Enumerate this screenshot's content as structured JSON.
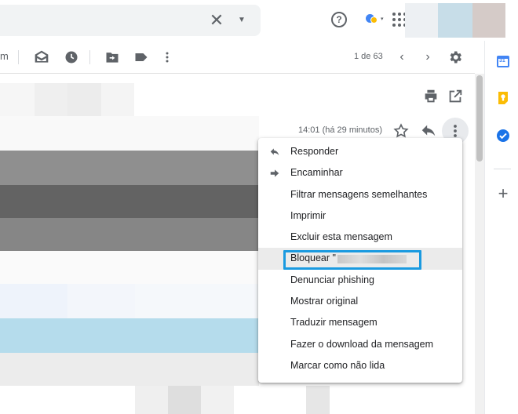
{
  "header": {
    "search_clear_glyph": "✕",
    "search_options_glyph": "▼",
    "help_glyph": "?",
    "status_caret_glyph": "▾",
    "icons": [
      "close-icon",
      "caret-down-icon",
      "help-icon",
      "status-icon",
      "apps-grid-icon"
    ]
  },
  "toolbar": {
    "partial_label": "m",
    "pager": "1 de 63",
    "prev_glyph": "‹",
    "next_glyph": "›",
    "icons": [
      "mark-read-icon",
      "snooze-icon",
      "move-to-icon",
      "label-icon",
      "more-vert-icon",
      "settings-icon"
    ]
  },
  "message": {
    "time": "14:01 (há 29 minutos)",
    "icons": [
      "print-icon",
      "open-new-window-icon",
      "star-icon",
      "reply-icon",
      "more-vert-icon"
    ]
  },
  "menu": {
    "items": [
      {
        "label": "Responder",
        "icon": "reply-icon"
      },
      {
        "label": "Encaminhar",
        "icon": "forward-icon"
      },
      {
        "label": "Filtrar mensagens semelhantes"
      },
      {
        "label": "Imprimir"
      },
      {
        "label": "Excluir esta mensagem"
      },
      {
        "label": "Bloquear \"",
        "blurred": true
      },
      {
        "label": "Denunciar phishing"
      },
      {
        "label": "Mostrar original"
      },
      {
        "label": "Traduzir mensagem"
      },
      {
        "label": "Fazer o download da mensagem"
      },
      {
        "label": "Marcar como não lida"
      }
    ]
  },
  "sidepanel": {
    "calendar_label": "31",
    "add_glyph": "+",
    "icons": [
      "calendar-icon",
      "keep-icon",
      "tasks-icon",
      "add-icon"
    ]
  },
  "colors": {
    "highlight": "#1a9ae0",
    "calendar": "#4285f4",
    "keep": "#fbbc04",
    "tasks": "#1a73e8"
  }
}
